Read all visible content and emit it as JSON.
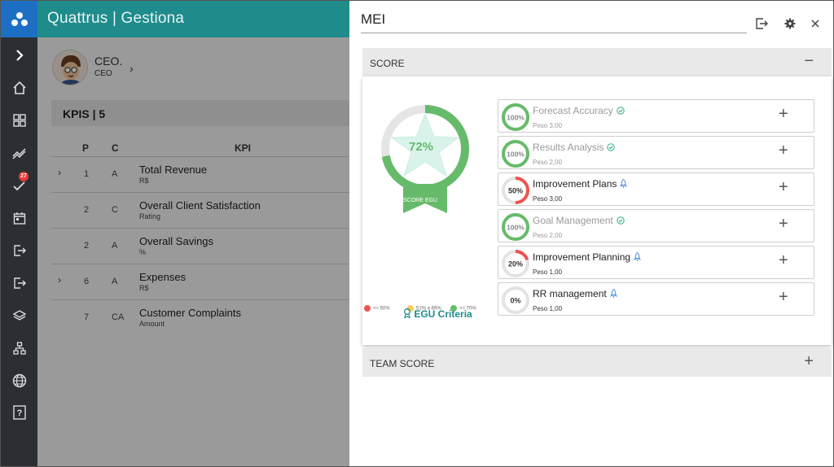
{
  "app": {
    "title": "Quattrus | Gestiona",
    "notification_count": "27"
  },
  "sidebar": {
    "icons": [
      "logo-icon",
      "expand-icon",
      "home-icon",
      "dashboard-icon",
      "trend-icon",
      "check-icon",
      "calendar-icon",
      "logout-icon",
      "exit-icon",
      "layers-icon",
      "hierarchy-icon",
      "globe-icon",
      "help-icon"
    ]
  },
  "user": {
    "name": "CEO.",
    "role": "CEO"
  },
  "kpi_list": {
    "header": "KPIS | 5",
    "columns": {
      "p": "P",
      "c": "C",
      "kpi": "KPI"
    },
    "rows": [
      {
        "p": "1",
        "c": "A",
        "name": "Total Revenue",
        "unit": "R$",
        "expandable": true
      },
      {
        "p": "2",
        "c": "C",
        "name": "Overall Client Satisfaction",
        "unit": "Rating",
        "expandable": false
      },
      {
        "p": "2",
        "c": "A",
        "name": "Overall Savings",
        "unit": "%",
        "expandable": false
      },
      {
        "p": "6",
        "c": "A",
        "name": "Expenses",
        "unit": "R$",
        "expandable": true
      },
      {
        "p": "7",
        "c": "CA",
        "name": "Customer Complaints",
        "unit": "Amount",
        "expandable": false
      }
    ]
  },
  "panel": {
    "title": "MEI",
    "score_section": "SCORE",
    "team_section": "TEAM SCORE",
    "score": {
      "value": "72%",
      "fraction": 0.72,
      "label": "SCORE EGU",
      "legend": [
        {
          "label": "<= 50%",
          "color": "#ef5350"
        },
        {
          "label": "51% a 69%",
          "color": "#f8ce5a"
        },
        {
          "label": ">= 70%",
          "color": "#66bb6a"
        }
      ],
      "criteria_link": "EGU Criteria"
    },
    "kpis": [
      {
        "pct": "100%",
        "fraction": 1.0,
        "name": "Forecast Accuracy",
        "peso": "Peso 3,00",
        "status": "done",
        "dim": true
      },
      {
        "pct": "100%",
        "fraction": 1.0,
        "name": "Results Analysis",
        "peso": "Peso 2,00",
        "status": "done",
        "dim": true
      },
      {
        "pct": "50%",
        "fraction": 0.5,
        "name": "Improvement Plans",
        "peso": "Peso 3,00",
        "status": "pending",
        "dim": false
      },
      {
        "pct": "100%",
        "fraction": 1.0,
        "name": "Goal Management",
        "peso": "Peso 2,00",
        "status": "done",
        "dim": true
      },
      {
        "pct": "20%",
        "fraction": 0.2,
        "name": "Improvement Planning",
        "peso": "Peso 1,00",
        "status": "pending",
        "dim": false
      },
      {
        "pct": "0%",
        "fraction": 0.0,
        "name": "RR management",
        "peso": "Peso 1,00",
        "status": "pending",
        "dim": false
      }
    ]
  },
  "colors": {
    "teal": "#1f8b8b",
    "green": "#66bb6a",
    "red": "#ef5350",
    "rail": "#2b2e33",
    "accent_blue": "#1d6fc4"
  }
}
